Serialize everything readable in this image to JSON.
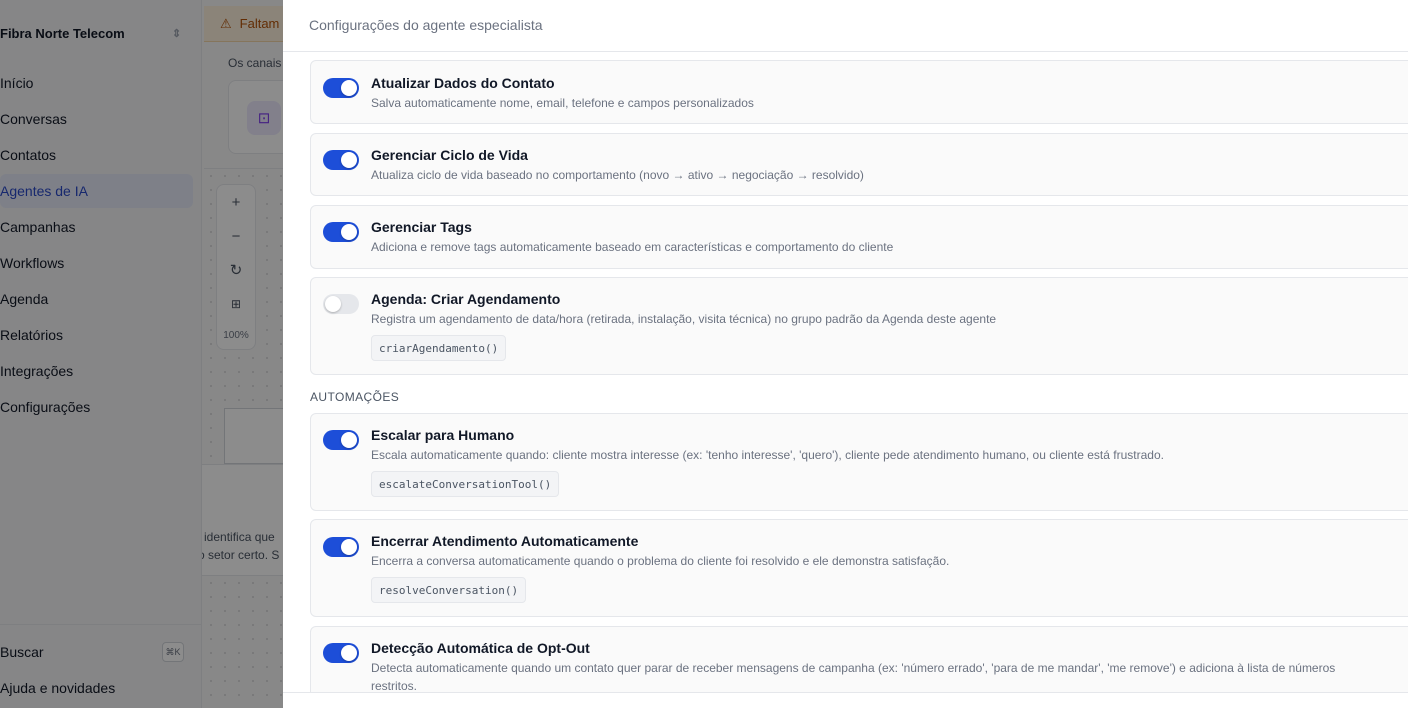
{
  "sidebar": {
    "org_name": "Fibra Norte Telecom",
    "items": [
      {
        "label": "Início",
        "active": false
      },
      {
        "label": "Conversas",
        "active": false
      },
      {
        "label": "Contatos",
        "active": false
      },
      {
        "label": "Agentes de IA",
        "active": true
      },
      {
        "label": "Campanhas",
        "active": false
      },
      {
        "label": "Workflows",
        "active": false
      },
      {
        "label": "Agenda",
        "active": false
      },
      {
        "label": "Relatórios",
        "active": false
      },
      {
        "label": "Integrações",
        "active": false
      },
      {
        "label": "Configurações",
        "active": false
      }
    ],
    "search_label": "Buscar",
    "search_shortcut": "⌘K",
    "help_label": "Ajuda e novidades"
  },
  "background": {
    "warning_text": "Faltam",
    "canais_text": "Os canais",
    "zoom_level": "100%",
    "hint_line1": "identifica que",
    "hint_line2": "o setor certo. S"
  },
  "panel": {
    "title": "Configurações do agente especialista",
    "section_automations": "AUTOMAÇÕES",
    "cards": [
      {
        "title": "Atualizar Dados do Contato",
        "description": "Salva automaticamente nome, email, telefone e campos personalizados",
        "enabled": true,
        "code": null
      },
      {
        "title": "Gerenciar Ciclo de Vida",
        "description": "Atualiza ciclo de vida baseado no comportamento (novo → ativo → negociação → resolvido)",
        "enabled": true,
        "code": null
      },
      {
        "title": "Gerenciar Tags",
        "description": "Adiciona e remove tags automaticamente baseado em características e comportamento do cliente",
        "enabled": true,
        "code": null
      },
      {
        "title": "Agenda: Criar Agendamento",
        "description": "Registra um agendamento de data/hora (retirada, instalação, visita técnica) no grupo padrão da Agenda deste agente",
        "enabled": false,
        "code": "criarAgendamento()"
      },
      {
        "title": "Escalar para Humano",
        "description": "Escala automaticamente quando: cliente mostra interesse (ex: 'tenho interesse', 'quero'), cliente pede atendimento humano, ou cliente está frustrado.",
        "enabled": true,
        "code": "escalateConversationTool()"
      },
      {
        "title": "Encerrar Atendimento Automaticamente",
        "description": "Encerra a conversa automaticamente quando o problema do cliente foi resolvido e ele demonstra satisfação.",
        "enabled": true,
        "code": "resolveConversation()"
      },
      {
        "title": "Detecção Automática de Opt-Out",
        "description": "Detecta automaticamente quando um contato quer parar de receber mensagens de campanha (ex: 'número errado', 'para de me mandar', 'me remove') e adiciona à lista de números restritos.",
        "enabled": true,
        "code": null
      }
    ]
  },
  "colors": {
    "toggle_on": "#1d4ed8",
    "toggle_off": "#e5e7eb",
    "active_nav": "#2b49c9",
    "warning": "#b45309"
  }
}
